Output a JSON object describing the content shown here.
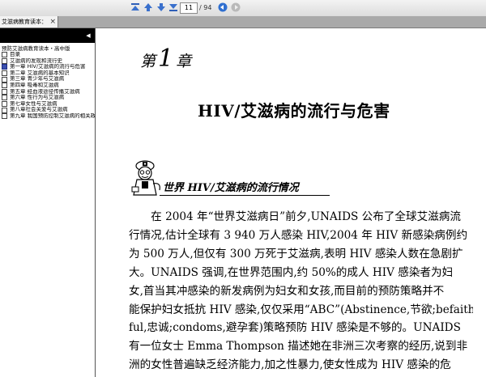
{
  "toolbar": {
    "first_page_icon": "first-page-icon",
    "prev_page_icon": "previous-page-icon",
    "next_page_icon": "next-page-icon",
    "last_page_icon": "last-page-icon",
    "current_page": "11",
    "page_total": "/ 94",
    "back_icon": "back-icon",
    "forward_icon": "forward-icon"
  },
  "tab": {
    "title": "艾滋病教育读本：高...",
    "close": "×"
  },
  "sidebar": {
    "collapse_icon": "collapse-arrow-icon",
    "root": "预防艾滋病教育读本・高中版",
    "items": [
      {
        "label": "目录",
        "checked": false
      },
      {
        "label": "艾滋病的发现和流行史",
        "checked": false
      },
      {
        "label": "第一章  HIV/艾滋病的流行与危害",
        "checked": true
      },
      {
        "label": "第二章  艾滋病的基本知识",
        "checked": false
      },
      {
        "label": "第三章  青少年与艾滋病",
        "checked": false
      },
      {
        "label": "第四章  吸毒和艾滋病",
        "checked": false
      },
      {
        "label": "第五章  经血液途径传播艾滋病",
        "checked": false
      },
      {
        "label": "第六章  性行为与艾滋病",
        "checked": false
      },
      {
        "label": "第七章女性与艾滋病",
        "checked": false
      },
      {
        "label": "第八章社会关爱与艾滋病",
        "checked": false
      },
      {
        "label": "第九章  我国预防控制艾滋病的相关政策",
        "checked": false
      }
    ]
  },
  "document": {
    "chapter_prefix": "第",
    "chapter_number": "1",
    "chapter_suffix": "章",
    "chapter_title": "HIV/艾滋病的流行与危害",
    "section_title": "世界 HIV/艾滋病的流行情况",
    "paragraph_lines": [
      "　　在 2004 年“世界艾滋病日”前夕,UNAIDS 公布了全球艾滋病流",
      "行情况,估计全球有 3 940 万人感染 HIV,2004 年 HIV 新感染病例约",
      "为 500 万人,但仅有 300 万死于艾滋病,表明 HIV 感染人数在急剧扩",
      "大。UNAIDS 强调,在世界范围内,约 50%的成人 HIV 感染者为妇",
      "女,首当其冲感染的新发病例为妇女和女孩,而目前的预防策略并不",
      "能保护妇女抵抗 HIV 感染,仅仅采用“ABC”(Abstinence,节欲;befaith-",
      "ful,忠诚;condoms,避孕套)策略预防 HIV 感染是不够的。UNAIDS",
      "有一位女士 Emma Thompson 描述她在非洲三次考察的经历,说到非",
      "洲的女性普遍缺乏经济能力,加之性暴力,使女性成为 HIV 感染的危"
    ]
  }
}
